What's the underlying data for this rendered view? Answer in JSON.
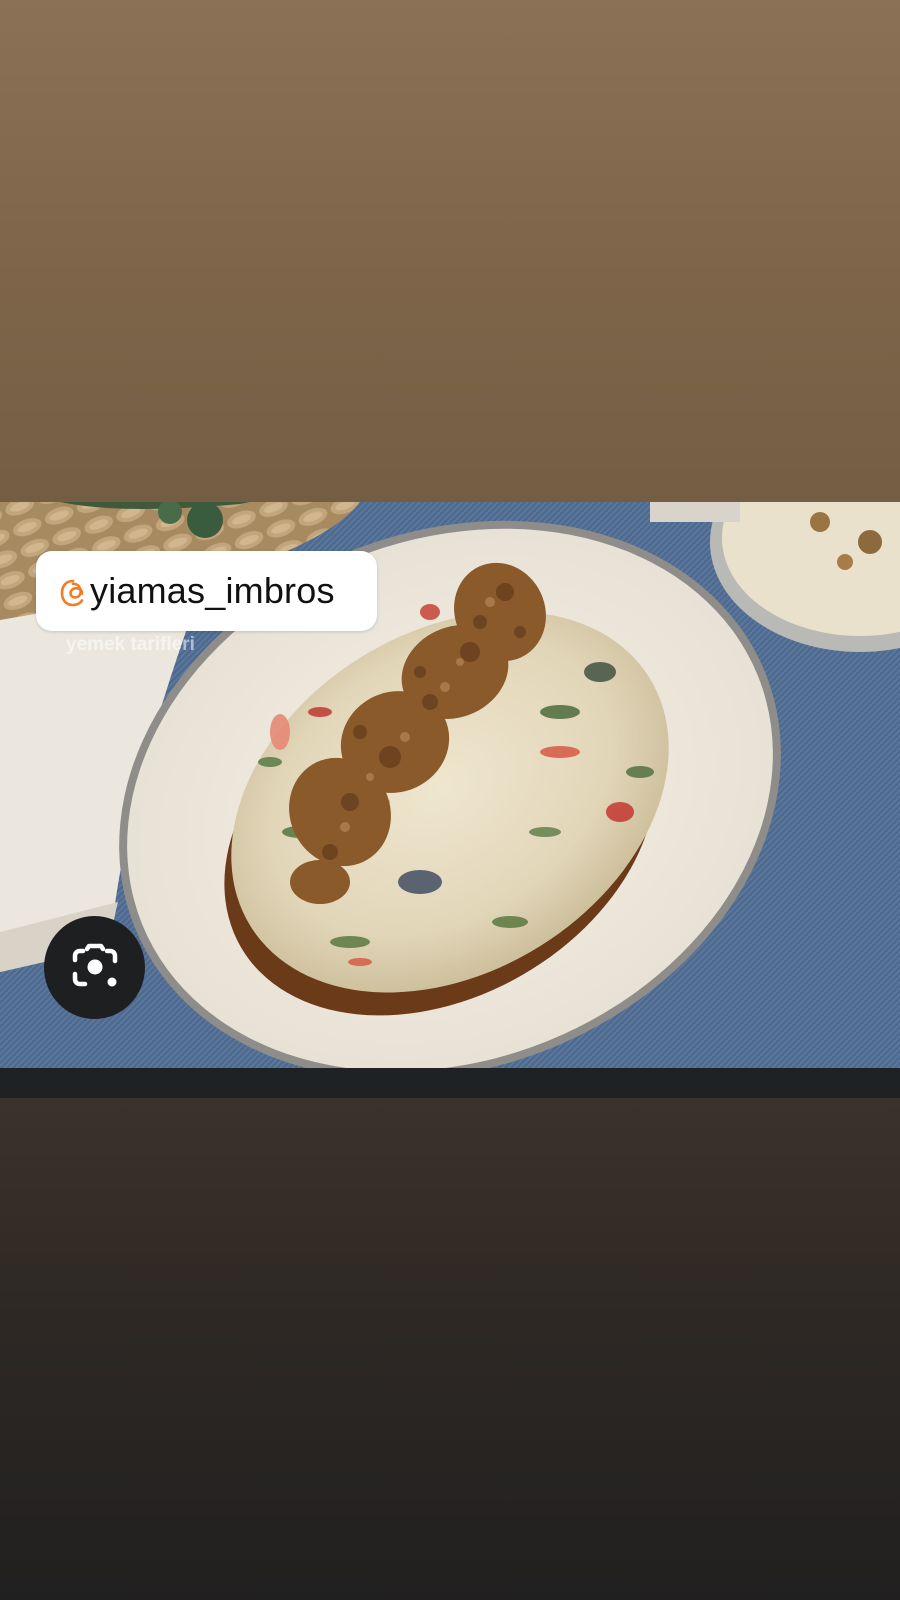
{
  "story": {
    "mention": {
      "handle": "yiamas_imbros",
      "icon": "threads-icon",
      "icon_color": "#f47b20"
    },
    "photo": {
      "watermark": "yemek tarifleri",
      "description_icon": "food-photo"
    },
    "lens_button": {
      "icon": "camera-lens-icon"
    },
    "colors": {
      "top_background": "#8b7155",
      "bottom_background": "#212020",
      "button_background": "#1e1f20"
    }
  }
}
